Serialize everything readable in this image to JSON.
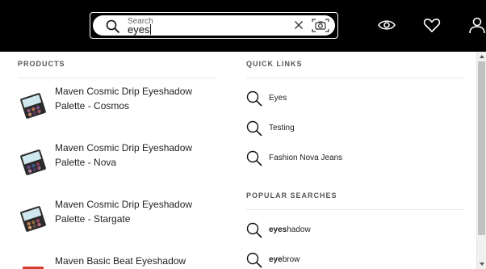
{
  "search": {
    "label": "Search",
    "value": "eyes"
  },
  "products": {
    "title": "PRODUCTS",
    "items": [
      {
        "name": "Maven Cosmic Drip Eyeshadow Palette - Cosmos"
      },
      {
        "name": "Maven Cosmic Drip Eyeshadow Palette - Nova"
      },
      {
        "name": "Maven Cosmic Drip Eyeshadow Palette - Stargate"
      },
      {
        "name": "Maven Basic Beat Eyeshadow"
      }
    ]
  },
  "quick_links": {
    "title": "QUICK LINKS",
    "items": [
      {
        "label": "Eyes"
      },
      {
        "label": "Testing"
      },
      {
        "label": "Fashion Nova Jeans"
      }
    ]
  },
  "popular_searches": {
    "title": "POPULAR SEARCHES",
    "items": [
      {
        "match": "eyes",
        "rest": "hadow"
      },
      {
        "match": "eye",
        "rest": "brow"
      }
    ]
  },
  "colors": {
    "header_bg": "#000000",
    "palette_case": "#2b2b2b",
    "accent_red": "#d33a2c"
  },
  "icons": [
    "search-icon",
    "clear-icon",
    "camera-icon",
    "eye-icon",
    "heart-icon",
    "user-icon"
  ]
}
